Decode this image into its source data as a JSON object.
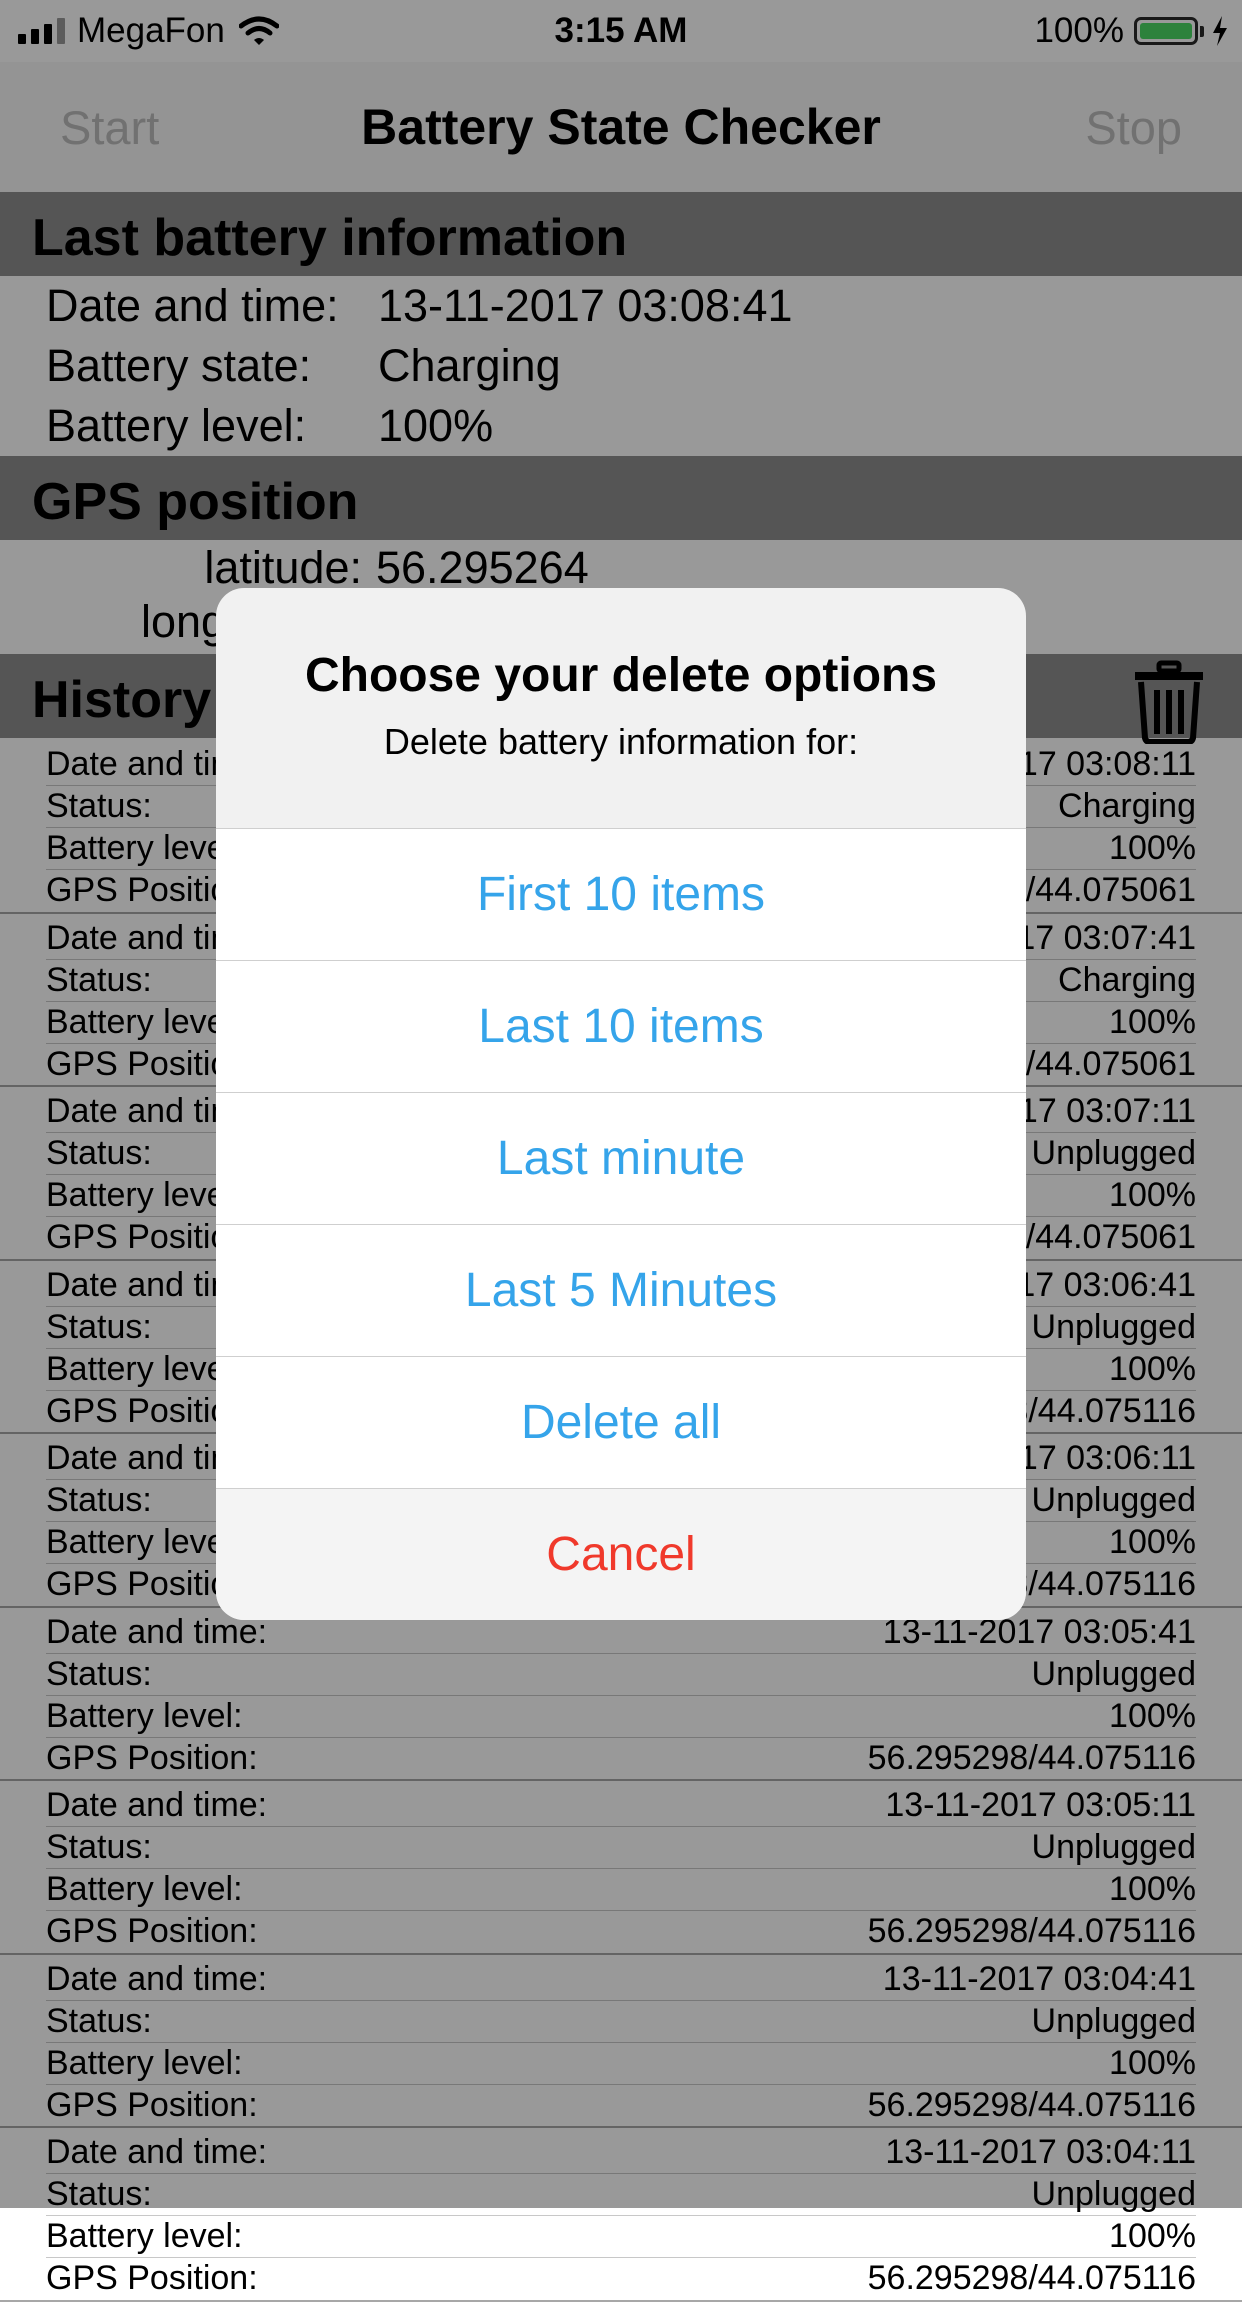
{
  "status_bar": {
    "carrier": "MegaFon",
    "time": "3:15 AM",
    "battery_percent": "100%"
  },
  "nav": {
    "title": "Battery State Checker",
    "start_label": "Start",
    "stop_label": "Stop"
  },
  "last_battery": {
    "header": "Last battery information",
    "date_label": "Date and time:",
    "date_value": "13-11-2017 03:08:41",
    "state_label": "Battery state:",
    "state_value": "Charging",
    "level_label": "Battery level:",
    "level_value": "100%"
  },
  "gps": {
    "header": "GPS position",
    "latitude_label": "latitude:",
    "latitude_value": "56.295264",
    "longitude_label_partial": "long"
  },
  "history": {
    "header": "History",
    "labels": {
      "date": "Date and time:",
      "status": "Status:",
      "level": "Battery level:",
      "gps": "GPS Position:"
    },
    "items": [
      {
        "date": "13-11-2017 03:08:11",
        "status": "Charging",
        "level": "100%",
        "gps": "56.295298/44.075061"
      },
      {
        "date": "13-11-2017 03:07:41",
        "status": "Charging",
        "level": "100%",
        "gps": "56.295298/44.075061"
      },
      {
        "date": "13-11-2017 03:07:11",
        "status": "Unplugged",
        "level": "100%",
        "gps": "56.295298/44.075061"
      },
      {
        "date": "13-11-2017 03:06:41",
        "status": "Unplugged",
        "level": "100%",
        "gps": "56.295298/44.075116"
      },
      {
        "date": "13-11-2017 03:06:11",
        "status": "Unplugged",
        "level": "100%",
        "gps": "56.295298/44.075116"
      },
      {
        "date": "13-11-2017 03:05:41",
        "status": "Unplugged",
        "level": "100%",
        "gps": "56.295298/44.075116"
      },
      {
        "date": "13-11-2017 03:05:11",
        "status": "Unplugged",
        "level": "100%",
        "gps": "56.295298/44.075116"
      },
      {
        "date": "13-11-2017 03:04:41",
        "status": "Unplugged",
        "level": "100%",
        "gps": "56.295298/44.075116"
      },
      {
        "date": "13-11-2017 03:04:11",
        "status": "Unplugged",
        "level": "100%",
        "gps": "56.295298/44.075116"
      }
    ]
  },
  "dialog": {
    "title": "Choose your delete options",
    "message": "Delete battery information for:",
    "options": [
      "First 10 items",
      "Last 10 items",
      "Last minute",
      "Last 5 Minutes",
      "Delete all"
    ],
    "cancel": "Cancel"
  },
  "colors": {
    "accent": "#35a4ea",
    "destructive": "#f0392b",
    "battery": "#4cd964",
    "section_header": "#8e8e8e"
  }
}
